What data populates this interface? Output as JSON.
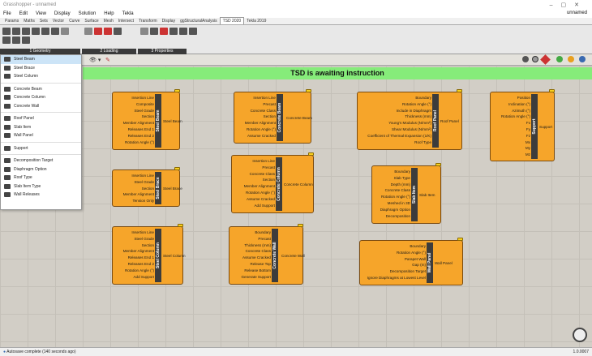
{
  "window": {
    "title": "Grasshopper - unnamed",
    "doc_name": "unnamed"
  },
  "menu": [
    "File",
    "Edit",
    "View",
    "Display",
    "Solution",
    "Help",
    "Tekla"
  ],
  "tabs": [
    "Params",
    "Maths",
    "Sets",
    "Vector",
    "Curve",
    "Surface",
    "Mesh",
    "Intersect",
    "Transform",
    "Display",
    "ggStructuralAnalysis",
    "TSD 2020",
    "Tekla 2019"
  ],
  "active_tab": "TSD 2020",
  "ribbon_groups": [
    "1 Geometry",
    "2 Loading",
    "3 Properties"
  ],
  "banner": "TSD is awaiting instruction",
  "dropdown": {
    "items": [
      "Steel Beam",
      "Steel Brace",
      "Steel Column",
      "Concrete Beam",
      "Concrete Column",
      "Concrete Wall",
      "Roof Panel",
      "Slab Item",
      "Wall Panel",
      "Support",
      "Decomposition Target",
      "Diaphragm Option",
      "Roof Type",
      "Slab Item Type",
      "Wall Releases"
    ]
  },
  "nodes": [
    {
      "name": "Steel Beam",
      "output": "Steel Beam",
      "inputs": [
        "Insertion Line",
        "Composite",
        "Steel Grade",
        "Section",
        "Member Alignment",
        "Releases End 1",
        "Releases End 2",
        "Rotation Angle (°)"
      ]
    },
    {
      "name": "Steel Brace",
      "output": "Steel Brace",
      "inputs": [
        "Insertion Line",
        "Steel Grade",
        "Section",
        "Member Alignment",
        "Tension Only"
      ]
    },
    {
      "name": "Steel Column",
      "output": "Steel Column",
      "inputs": [
        "Insertion Line",
        "Steel Grade",
        "Section",
        "Member Alignment",
        "Releases End 1",
        "Releases End 2",
        "Rotation Angle (°)",
        "Add Support"
      ]
    },
    {
      "name": "Concrete Beam",
      "output": "Concrete Beam",
      "inputs": [
        "Insertion Line",
        "Precast",
        "Concrete Class",
        "Section",
        "Member Alignment",
        "Rotation Angle (°)",
        "Assume Cracked"
      ]
    },
    {
      "name": "Concrete Column",
      "output": "Concrete Column",
      "inputs": [
        "Insertion Line",
        "Precast",
        "Concrete Class",
        "Section",
        "Member Alignment",
        "Rotation Angle (°)",
        "Assume Cracked",
        "Add Support"
      ]
    },
    {
      "name": "Concrete Wall",
      "output": "Concrete Wall",
      "inputs": [
        "Boundary",
        "Precast",
        "Thickness (mm)",
        "Concrete Class",
        "Assume Cracked",
        "Release Top",
        "Release Bottom",
        "Generate Support"
      ]
    },
    {
      "name": "Roof Panel",
      "output": "Roof Panel",
      "inputs": [
        "Boundary",
        "Rotation Angle (°)",
        "Include in Diaphragm",
        "Thickness (mm)",
        "Young's Modulus (N/mm²)",
        "Shear Modulus (N/mm²)",
        "Coefficient of Thermal Expansion (1/K)",
        "Roof Type"
      ]
    },
    {
      "name": "Slab Item",
      "output": "Slab Item",
      "inputs": [
        "Boundary",
        "Slab Type",
        "Depth (mm)",
        "Concrete Class",
        "Rotation Angle (°)",
        "Meshed in 3D",
        "Diaphragm Option",
        "Decomposition"
      ]
    },
    {
      "name": "Wall Panel",
      "output": "Wall Panel",
      "inputs": [
        "Boundary",
        "Rotation Angle (°)",
        "Parapet Wall",
        "Gap (m)",
        "Decomposition Target",
        "Ignore Diaphragms at Lowest Level"
      ]
    },
    {
      "name": "Support",
      "output": "Support",
      "inputs": [
        "Position",
        "Inclination (°)",
        "Azimuth (°)",
        "Rotation Angle (°)",
        "Fx",
        "Fy",
        "Fz",
        "Mx",
        "My",
        "Mz"
      ]
    }
  ],
  "status": {
    "message": "Autosave complete (140 seconds ago)",
    "version": "1.0.0007"
  }
}
